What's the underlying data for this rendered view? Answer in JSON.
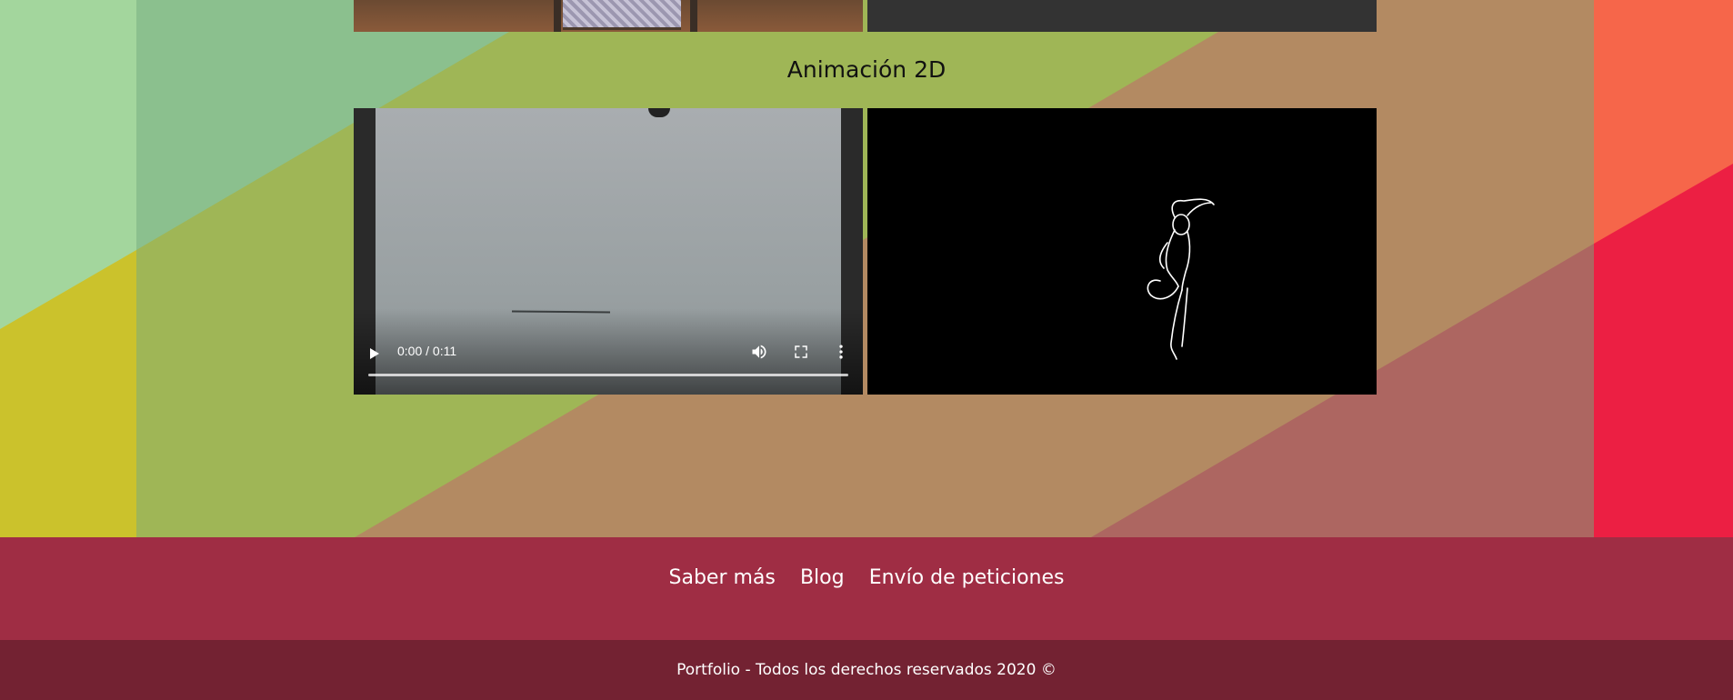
{
  "colors": {
    "green_light": "#a3d69d",
    "green_mid": "#8bc08e",
    "olive": "#9fb656",
    "yellow": "#cbc22c",
    "tan": "#b38a62",
    "rose": "#ad6661",
    "orange": "#f6664a",
    "red": "#ec1f43",
    "footer_nav_bg": "#9f2d44",
    "footer_bottom_bg": "#732232",
    "video_right_bg": "#000000",
    "video_placeholder_bg": "#333333"
  },
  "section": {
    "heading": "Animación 2D"
  },
  "video_left": {
    "time_display": "0:00 / 0:11",
    "play_icon": "play-icon",
    "volume_icon": "volume-icon",
    "fullscreen_icon": "fullscreen-icon",
    "more_icon": "more-vertical-icon"
  },
  "footer": {
    "nav": [
      "Saber más",
      "Blog",
      "Envío de peticiones"
    ],
    "copyright": "Portfolio - Todos los derechos reservados 2020 ©"
  }
}
